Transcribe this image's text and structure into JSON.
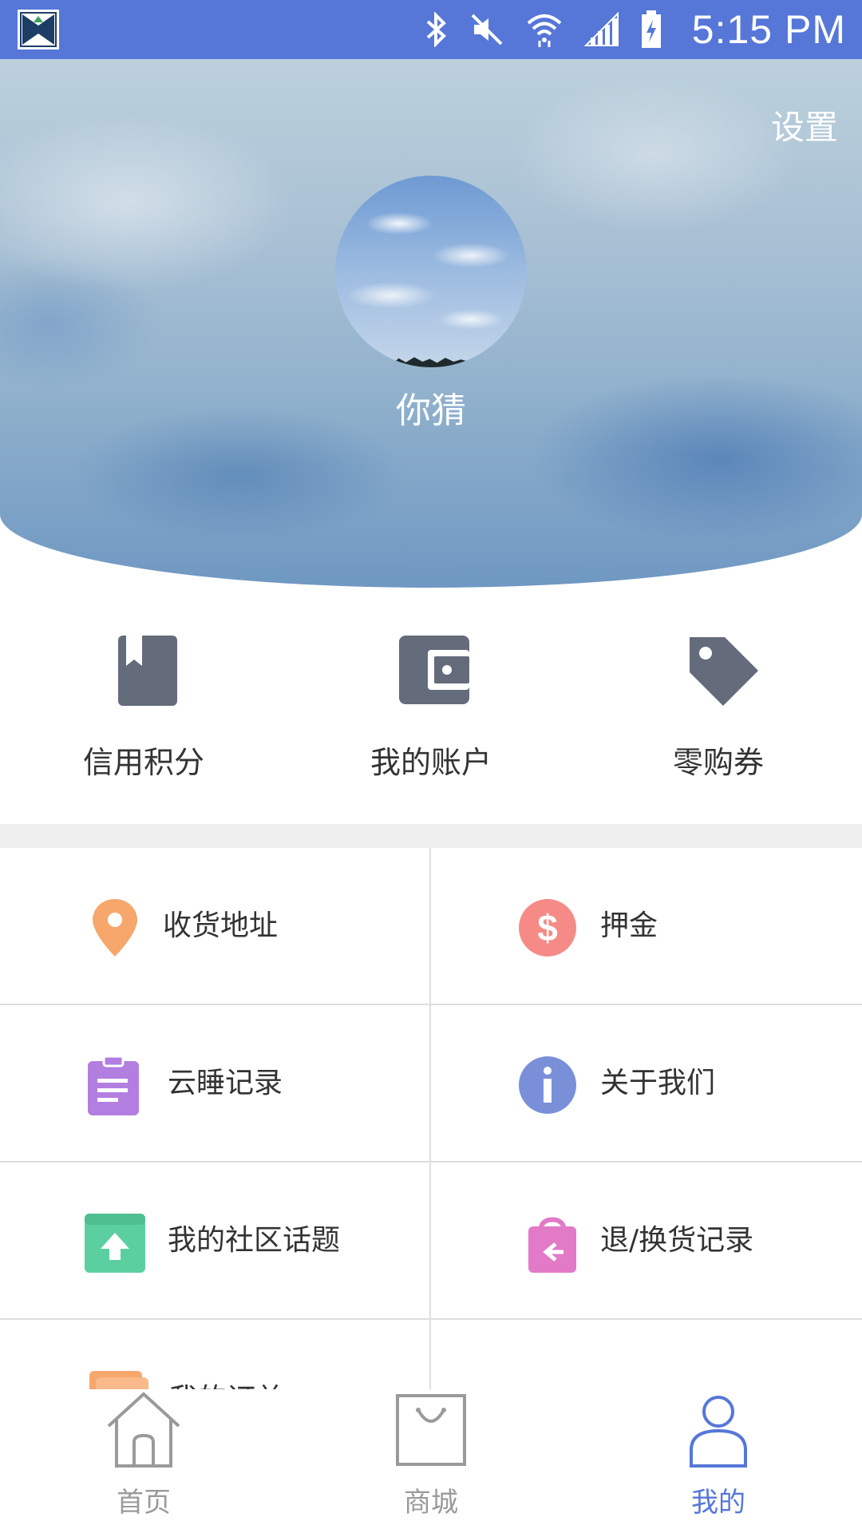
{
  "status_bar": {
    "time": "5:15 PM",
    "icons": [
      "app-logo-icon",
      "bluetooth-icon",
      "mute-icon",
      "wifi-icon",
      "signal-icon",
      "battery-charging-icon"
    ],
    "background_color": "#5677d8"
  },
  "header": {
    "settings_label": "设置",
    "user_name": "你猜"
  },
  "quick_actions": [
    {
      "label": "信用积分",
      "icon": "bookmark-book-icon",
      "color": "#646b7b"
    },
    {
      "label": "我的账户",
      "icon": "wallet-icon",
      "color": "#646b7b"
    },
    {
      "label": "零购券",
      "icon": "tag-icon",
      "color": "#646b7b"
    }
  ],
  "menu_items": [
    {
      "label": "收货地址",
      "icon": "location-pin-icon",
      "color": "#f7a76c"
    },
    {
      "label": "押金",
      "icon": "dollar-icon",
      "color": "#f58a87"
    },
    {
      "label": "云睡记录",
      "icon": "clipboard-icon",
      "color": "#b27ee0"
    },
    {
      "label": "关于我们",
      "icon": "info-icon",
      "color": "#7990d9"
    },
    {
      "label": "我的社区话题",
      "icon": "upload-box-icon",
      "color": "#5ccfa0"
    },
    {
      "label": "退/换货记录",
      "icon": "shopping-bag-return-icon",
      "color": "#e27ac8"
    },
    {
      "label": "我的订单",
      "icon": "order-cards-icon",
      "color": "#f7a76c"
    }
  ],
  "bottom_nav": [
    {
      "label": "首页",
      "icon": "home-icon",
      "active": false
    },
    {
      "label": "商城",
      "icon": "shopping-bag-icon",
      "active": false
    },
    {
      "label": "我的",
      "icon": "user-icon",
      "active": true
    }
  ],
  "colors": {
    "accent": "#5677d8",
    "icon_gray": "#646b7b",
    "nav_inactive": "#9a9a9a"
  }
}
